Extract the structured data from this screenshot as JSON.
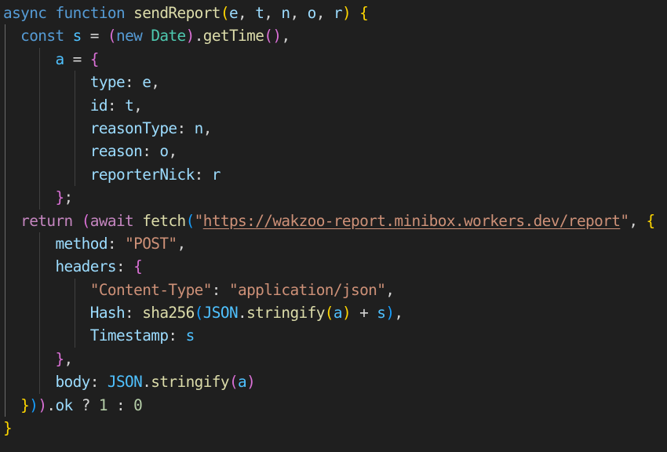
{
  "editor": {
    "language": "javascript",
    "theme": "dark",
    "colors": {
      "background": "#1f1f1f",
      "keyword": "#569cd6",
      "control": "#c586c0",
      "function": "#dcdcaa",
      "variable": "#9cdcfe",
      "string": "#ce9178",
      "bracket_level_1": "#ffd700",
      "bracket_level_2": "#da70d6",
      "bracket_level_3": "#179fff"
    }
  },
  "code": {
    "lines": [
      {
        "indent": 0,
        "tokens": [
          {
            "t": "async",
            "c": "kw"
          },
          {
            "t": " "
          },
          {
            "t": "function",
            "c": "kw"
          },
          {
            "t": " "
          },
          {
            "t": "sendReport",
            "c": "fn"
          },
          {
            "t": "(",
            "c": "b1"
          },
          {
            "t": "e",
            "c": "var"
          },
          {
            "t": ", ",
            "c": "pun"
          },
          {
            "t": "t",
            "c": "var"
          },
          {
            "t": ", ",
            "c": "pun"
          },
          {
            "t": "n",
            "c": "var"
          },
          {
            "t": ", ",
            "c": "pun"
          },
          {
            "t": "o",
            "c": "var"
          },
          {
            "t": ", ",
            "c": "pun"
          },
          {
            "t": "r",
            "c": "var"
          },
          {
            "t": ")",
            "c": "b1"
          },
          {
            "t": " "
          },
          {
            "t": "{",
            "c": "b1"
          }
        ]
      },
      {
        "indent": 1,
        "tokens": [
          {
            "t": "const",
            "c": "kw"
          },
          {
            "t": " "
          },
          {
            "t": "s",
            "c": "cst"
          },
          {
            "t": " = ",
            "c": "pun"
          },
          {
            "t": "(",
            "c": "b2"
          },
          {
            "t": "new",
            "c": "kw"
          },
          {
            "t": " "
          },
          {
            "t": "Date",
            "c": "cls"
          },
          {
            "t": ")",
            "c": "b2"
          },
          {
            "t": ".",
            "c": "pun"
          },
          {
            "t": "getTime",
            "c": "fn"
          },
          {
            "t": "()",
            "c": "b2"
          },
          {
            "t": ",",
            "c": "pun"
          }
        ]
      },
      {
        "indent": 2,
        "tokens": [
          {
            "t": "a",
            "c": "cst"
          },
          {
            "t": " = ",
            "c": "pun"
          },
          {
            "t": "{",
            "c": "b2"
          }
        ]
      },
      {
        "indent": 3,
        "tokens": [
          {
            "t": "type",
            "c": "var"
          },
          {
            "t": ": ",
            "c": "pun"
          },
          {
            "t": "e",
            "c": "var"
          },
          {
            "t": ",",
            "c": "pun"
          }
        ]
      },
      {
        "indent": 3,
        "tokens": [
          {
            "t": "id",
            "c": "var"
          },
          {
            "t": ": ",
            "c": "pun"
          },
          {
            "t": "t",
            "c": "var"
          },
          {
            "t": ",",
            "c": "pun"
          }
        ]
      },
      {
        "indent": 3,
        "tokens": [
          {
            "t": "reasonType",
            "c": "var"
          },
          {
            "t": ": ",
            "c": "pun"
          },
          {
            "t": "n",
            "c": "var"
          },
          {
            "t": ",",
            "c": "pun"
          }
        ]
      },
      {
        "indent": 3,
        "tokens": [
          {
            "t": "reason",
            "c": "var"
          },
          {
            "t": ": ",
            "c": "pun"
          },
          {
            "t": "o",
            "c": "var"
          },
          {
            "t": ",",
            "c": "pun"
          }
        ]
      },
      {
        "indent": 3,
        "tokens": [
          {
            "t": "reporterNick",
            "c": "var"
          },
          {
            "t": ": ",
            "c": "pun"
          },
          {
            "t": "r",
            "c": "var"
          }
        ]
      },
      {
        "indent": 2,
        "tokens": [
          {
            "t": "}",
            "c": "b2"
          },
          {
            "t": ";",
            "c": "pun"
          }
        ]
      },
      {
        "indent": 1,
        "tokens": [
          {
            "t": "return",
            "c": "ctl"
          },
          {
            "t": " "
          },
          {
            "t": "(",
            "c": "b2"
          },
          {
            "t": "await",
            "c": "ctl"
          },
          {
            "t": " "
          },
          {
            "t": "fetch",
            "c": "fn"
          },
          {
            "t": "(",
            "c": "b3"
          },
          {
            "t": "\""
          },
          {
            "t": "https://wakzoo-report.minibox.workers.dev/report",
            "c": "url"
          },
          {
            "t": "\"",
            "c": "str"
          },
          {
            "t": ", ",
            "c": "pun"
          },
          {
            "t": "{",
            "c": "b1"
          }
        ]
      },
      {
        "indent": 2,
        "tokens": [
          {
            "t": "method",
            "c": "var"
          },
          {
            "t": ": ",
            "c": "pun"
          },
          {
            "t": "\"POST\"",
            "c": "str"
          },
          {
            "t": ",",
            "c": "pun"
          }
        ]
      },
      {
        "indent": 2,
        "tokens": [
          {
            "t": "headers",
            "c": "var"
          },
          {
            "t": ": ",
            "c": "pun"
          },
          {
            "t": "{",
            "c": "b2"
          }
        ]
      },
      {
        "indent": 3,
        "tokens": [
          {
            "t": "\"Content-Type\"",
            "c": "str"
          },
          {
            "t": ": ",
            "c": "pun"
          },
          {
            "t": "\"application/json\"",
            "c": "str"
          },
          {
            "t": ",",
            "c": "pun"
          }
        ]
      },
      {
        "indent": 3,
        "tokens": [
          {
            "t": "Hash",
            "c": "var"
          },
          {
            "t": ": ",
            "c": "pun"
          },
          {
            "t": "sha256",
            "c": "fn"
          },
          {
            "t": "(",
            "c": "b3"
          },
          {
            "t": "JSON",
            "c": "cst"
          },
          {
            "t": ".",
            "c": "pun"
          },
          {
            "t": "stringify",
            "c": "fn"
          },
          {
            "t": "(",
            "c": "b1"
          },
          {
            "t": "a",
            "c": "cst"
          },
          {
            "t": ")",
            "c": "b1"
          },
          {
            "t": " + ",
            "c": "pun"
          },
          {
            "t": "s",
            "c": "cst"
          },
          {
            "t": ")",
            "c": "b3"
          },
          {
            "t": ",",
            "c": "pun"
          }
        ]
      },
      {
        "indent": 3,
        "tokens": [
          {
            "t": "Timestamp",
            "c": "var"
          },
          {
            "t": ": ",
            "c": "pun"
          },
          {
            "t": "s",
            "c": "cst"
          }
        ]
      },
      {
        "indent": 2,
        "tokens": [
          {
            "t": "}",
            "c": "b2"
          },
          {
            "t": ",",
            "c": "pun"
          }
        ]
      },
      {
        "indent": 2,
        "tokens": [
          {
            "t": "body",
            "c": "var"
          },
          {
            "t": ": ",
            "c": "pun"
          },
          {
            "t": "JSON",
            "c": "cst"
          },
          {
            "t": ".",
            "c": "pun"
          },
          {
            "t": "stringify",
            "c": "fn"
          },
          {
            "t": "(",
            "c": "b2"
          },
          {
            "t": "a",
            "c": "cst"
          },
          {
            "t": ")",
            "c": "b2"
          }
        ]
      },
      {
        "indent": 1,
        "tokens": [
          {
            "t": "}",
            "c": "b1"
          },
          {
            "t": ")",
            "c": "b3"
          },
          {
            "t": ")",
            "c": "b2"
          },
          {
            "t": ".",
            "c": "pun"
          },
          {
            "t": "ok",
            "c": "var"
          },
          {
            "t": " ? ",
            "c": "pun"
          },
          {
            "t": "1",
            "c": "num"
          },
          {
            "t": " : ",
            "c": "pun"
          },
          {
            "t": "0",
            "c": "num"
          }
        ]
      },
      {
        "indent": 0,
        "tokens": [
          {
            "t": "}",
            "c": "b1"
          }
        ]
      }
    ]
  }
}
